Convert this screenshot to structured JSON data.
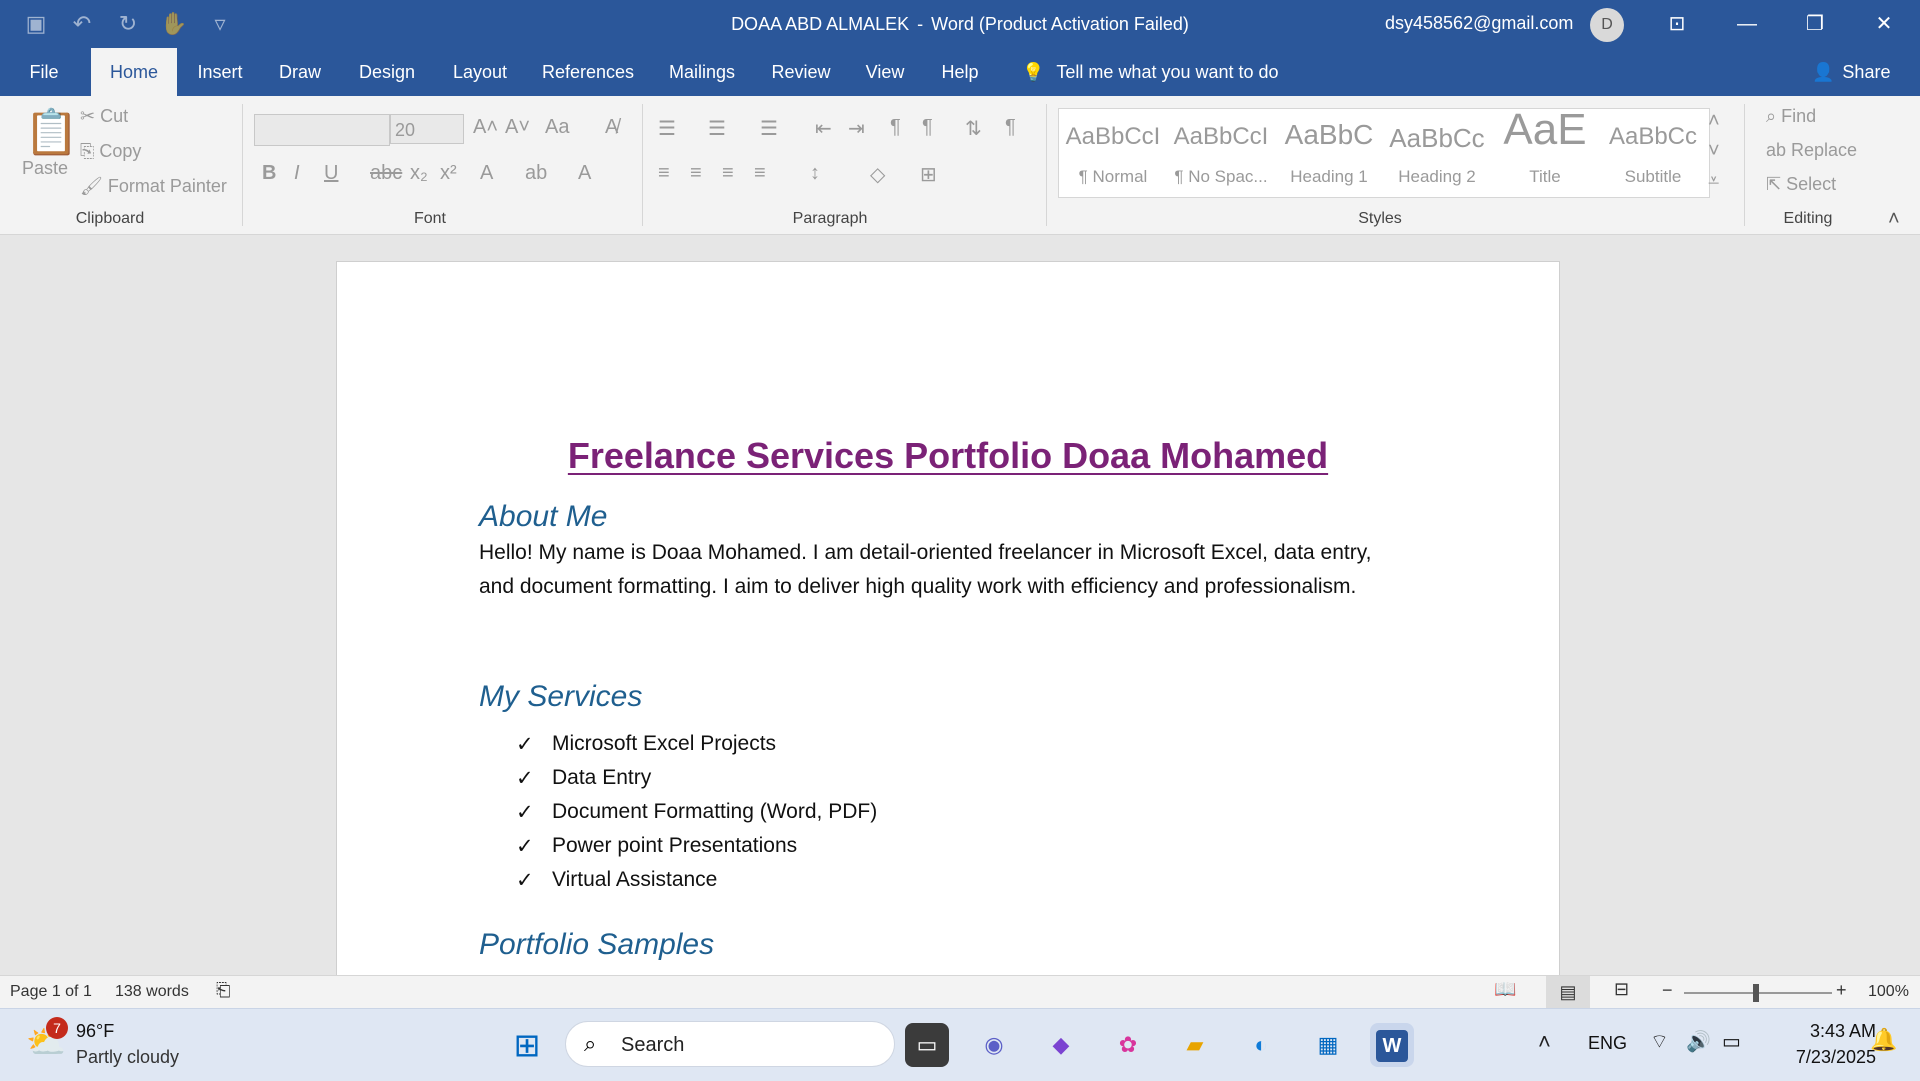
{
  "window": {
    "title": "DOAA ABD ALMALEK",
    "title_sep": "-",
    "app": "Word (Product Activation Failed)",
    "account_email": "dsy458562@gmail.com",
    "avatar_initial": "D"
  },
  "tabs": [
    "File",
    "Home",
    "Insert",
    "Draw",
    "Design",
    "Layout",
    "References",
    "Mailings",
    "Review",
    "View",
    "Help"
  ],
  "active_tab": "Home",
  "tell_me": "Tell me what you want to do",
  "share": "Share",
  "ribbon": {
    "clipboard": {
      "paste": "Paste",
      "cut": "Cut",
      "copy": "Copy",
      "format_painter": "Format Painter",
      "label": "Clipboard"
    },
    "font": {
      "size": "20",
      "label": "Font"
    },
    "paragraph": {
      "label": "Paragraph"
    },
    "styles": {
      "label": "Styles",
      "items": [
        {
          "preview": "AaBbCcI",
          "name": "¶ Normal"
        },
        {
          "preview": "AaBbCcI",
          "name": "¶ No Spac..."
        },
        {
          "preview": "AaBbC",
          "name": "Heading 1"
        },
        {
          "preview": "AaBbCc",
          "name": "Heading 2"
        },
        {
          "preview": "AaE",
          "name": "Title"
        },
        {
          "preview": "AaBbCc",
          "name": "Subtitle"
        }
      ]
    },
    "editing": {
      "find": "Find",
      "replace": "Replace",
      "select": "Select",
      "label": "Editing"
    }
  },
  "document": {
    "title": "Freelance Services Portfolio Doaa Mohamed",
    "about_heading": "About Me",
    "about_text": "Hello! My name is Doaa Mohamed. I am detail-oriented freelancer in Microsoft Excel, data entry, and document formatting. I aim to deliver high quality work with efficiency and professionalism.",
    "services_heading": "My Services",
    "services": [
      "Microsoft Excel Projects",
      "Data Entry",
      "Document Formatting (Word, PDF)",
      "Power point Presentations",
      "Virtual Assistance"
    ],
    "portfolio_heading": "Portfolio Samples"
  },
  "status": {
    "page": "Page 1 of 1",
    "words": "138 words",
    "zoom": "100%"
  },
  "taskbar": {
    "weather_temp": "96°F",
    "weather_desc": "Partly cloudy",
    "weather_badge": "7",
    "search_label": "Search",
    "lang": "ENG",
    "time": "3:43 AM",
    "date": "7/23/2025"
  }
}
